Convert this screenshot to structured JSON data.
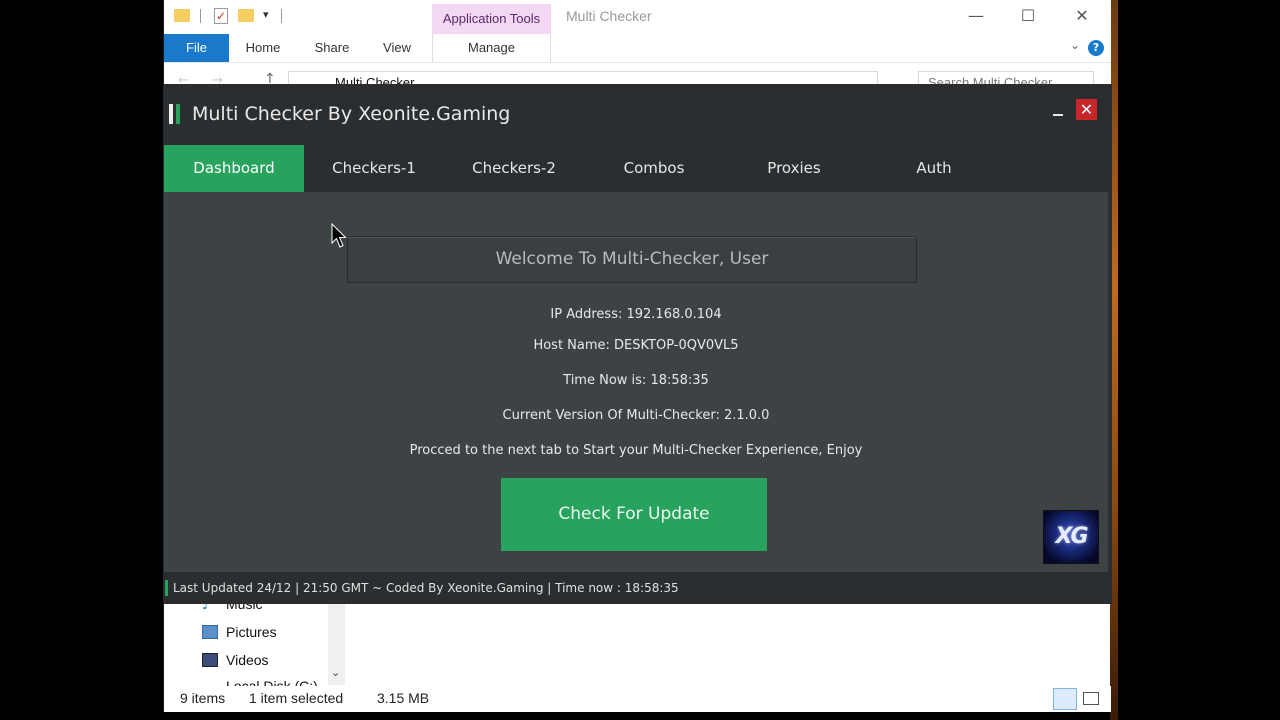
{
  "explorer": {
    "contextual_tab": "Application Tools",
    "title": "Multi Checker",
    "ribbon_tabs": [
      "File",
      "Home",
      "Share",
      "View",
      "Manage"
    ],
    "address": "Multi Checker",
    "search_placeholder": "Search Multi Checker",
    "nav_items": [
      "Music",
      "Pictures",
      "Videos",
      "Local Disk (C:)"
    ],
    "status": {
      "items": "9 items",
      "selected": "1 item selected",
      "size": "3.15 MB"
    },
    "icons": {
      "folder": "folder-icon",
      "help": "help-icon",
      "minimize": "minimize-icon",
      "maximize": "maximize-icon",
      "close": "close-icon"
    }
  },
  "app": {
    "title": "Multi Checker By Xeonite.Gaming",
    "tabs": [
      "Dashboard",
      "Checkers-1",
      "Checkers-2",
      "Combos",
      "Proxies",
      "Auth"
    ],
    "active_tab": "Dashboard",
    "welcome": "Welcome To Multi-Checker, User",
    "ip_line": "IP Address: 192.168.0.104",
    "host_line": "Host Name: DESKTOP-0QV0VL5",
    "time_line": "Time Now is: 18:58:35",
    "version_line": "Current Version Of Multi-Checker: 2.1.0.0",
    "proceed_line": "Procced to the next tab to Start your Multi-Checker Experience, Enjoy",
    "update_button": "Check For Update",
    "logo_text": "XG",
    "status_line": "Last Updated 24/12 | 21:50 GMT ~ Coded By Xeonite.Gaming | Time now : 18:58:35",
    "colors": {
      "accent": "#27a35e",
      "close": "#c9262b",
      "background": "#3d4245"
    }
  }
}
